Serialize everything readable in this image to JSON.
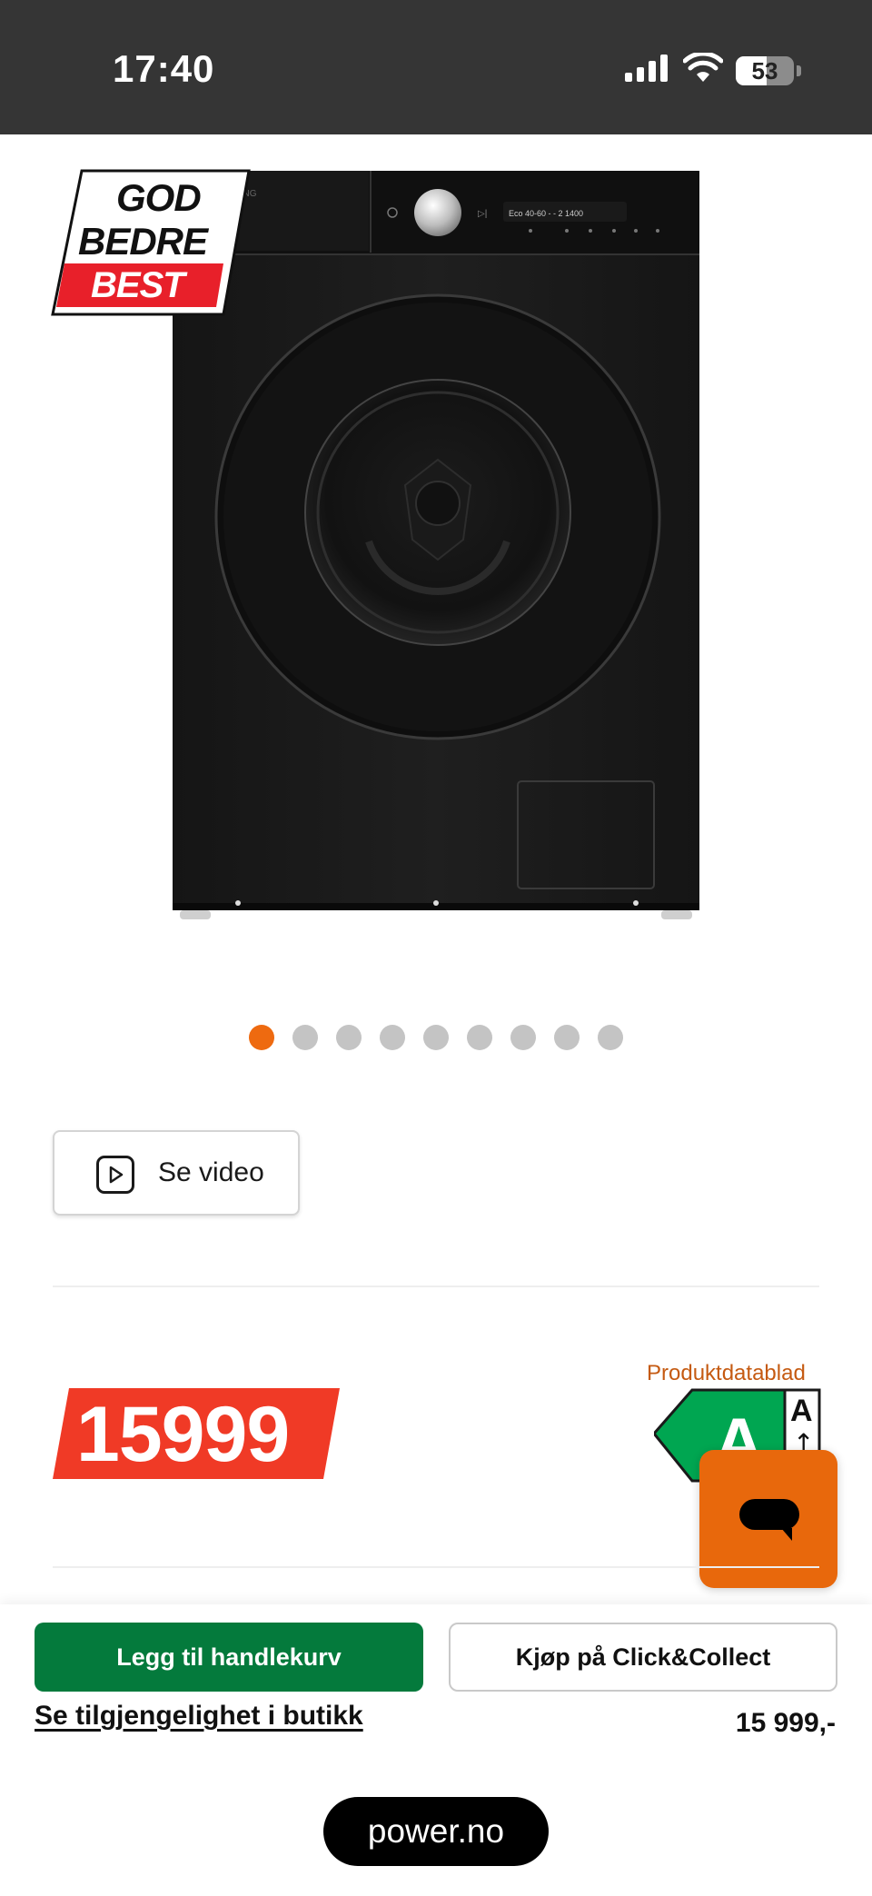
{
  "status_bar": {
    "time": "17:40",
    "battery_level": "53",
    "battery_fraction": 0.53,
    "signal_icon": "cellular-signal-icon",
    "wifi_icon": "wifi-icon"
  },
  "product": {
    "image_alt": "washing-machine-image",
    "badge": {
      "line1": "GOD",
      "line2": "BEDRE",
      "line3": "BEST"
    },
    "carousel": {
      "total": 9,
      "active_index": 0
    }
  },
  "video_button": {
    "label": "Se video",
    "icon": "play-icon"
  },
  "price": {
    "display": "15999"
  },
  "energy": {
    "datablad_link": "Produktdatablad",
    "class": "A",
    "scale_top": "A",
    "arrow": "↑"
  },
  "chat": {
    "icon": "chat-bubble-icon"
  },
  "actions": {
    "add_to_cart": "Legg til handlekurv",
    "click_collect": "Kjøp på Click&Collect",
    "availability": "Se tilgjengelighet i butikk",
    "price": "15 999,-"
  },
  "browser": {
    "url": "power.no"
  },
  "colors": {
    "accent_orange": "#ee6a10",
    "price_red": "#f03a26",
    "cart_green": "#047a3c",
    "energy_green": "#00a651",
    "link_orange": "#c55a11"
  }
}
